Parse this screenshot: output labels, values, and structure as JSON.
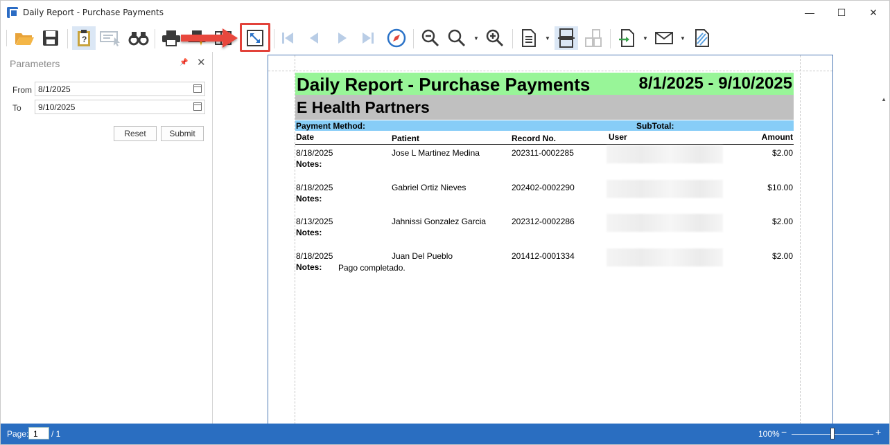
{
  "window": {
    "title": "Daily Report - Purchase Payments",
    "controls": {
      "minimize": "—",
      "maximize": "☐",
      "close": "✕"
    }
  },
  "toolbar": {
    "icons": [
      "open-folder-icon",
      "save-icon",
      "document-map-icon",
      "parameters-icon",
      "search-binoculars-icon",
      "print-icon",
      "quick-print-icon",
      "page-setup-icon",
      "fit-page-icon",
      "first-page-icon",
      "previous-page-icon",
      "next-page-icon",
      "last-page-icon",
      "navigate-icon",
      "zoom-out-icon",
      "zoom-icon",
      "zoom-in-icon",
      "page-layout-icon",
      "continuous-view-icon",
      "multiple-pages-icon",
      "export-icon",
      "send-email-icon",
      "watermark-icon"
    ],
    "highlighted": "fit-page-icon",
    "colors": {
      "highlight": "#e2423a",
      "accent": "#2a6ec1"
    }
  },
  "parameters": {
    "title": "Parameters",
    "pin": "📌",
    "close": "✕",
    "from_label": "From",
    "from_value": "8/1/2025",
    "to_label": "To",
    "to_value": "9/10/2025",
    "reset_label": "Reset",
    "submit_label": "Submit"
  },
  "report": {
    "title": "Daily Report - Purchase Payments",
    "date_range": "8/1/2025 - 9/10/2025",
    "company": "E Health Partners",
    "payment_method_label": "Payment Method:",
    "subtotal_label": "SubTotal:",
    "columns": {
      "date": "Date",
      "patient": "Patient",
      "record": "Record No.",
      "user": "User",
      "amount": "Amount"
    },
    "notes_label": "Notes:",
    "rows": [
      {
        "date": "8/18/2025",
        "patient": "Jose L Martinez Medina",
        "record": "202311-0002285",
        "amount": "$2.00",
        "notes": ""
      },
      {
        "date": "8/18/2025",
        "patient": "Gabriel Ortiz Nieves",
        "record": "202402-0002290",
        "amount": "$10.00",
        "notes": ""
      },
      {
        "date": "8/13/2025",
        "patient": "Jahnissi Gonzalez Garcia",
        "record": "202312-0002286",
        "amount": "$2.00",
        "notes": ""
      },
      {
        "date": "8/18/2025",
        "patient": "Juan Del Pueblo",
        "record": "201412-0001334",
        "amount": "$2.00",
        "notes": "Pago completado."
      }
    ]
  },
  "statusbar": {
    "page_label": "Page:",
    "page_value": "1",
    "page_total": "/ 1",
    "zoom": "100%",
    "zoom_minus": "−",
    "zoom_plus": "+",
    "zoom_slider_fraction": 0.5
  }
}
